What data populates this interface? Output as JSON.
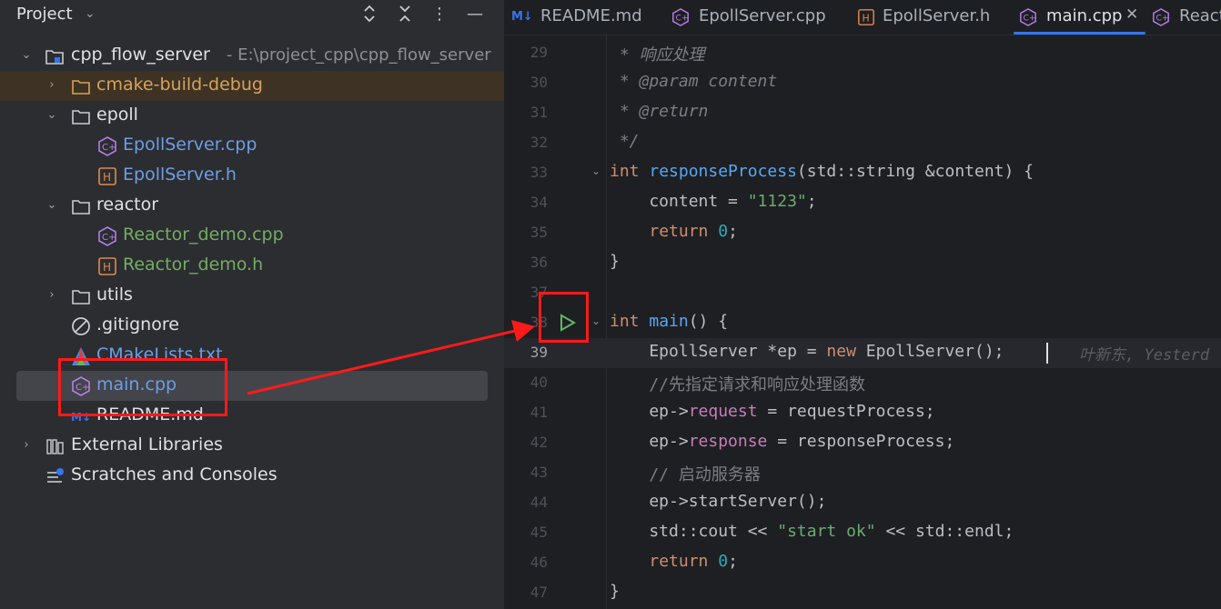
{
  "project_panel": {
    "title": "Project",
    "tree": [
      {
        "label": "cpp_flow_server",
        "extra": "- E:\\project_cpp\\cpp_flow_server",
        "kind": "folder"
      },
      {
        "label": "cmake-build-debug",
        "kind": "folder"
      },
      {
        "label": "epoll",
        "kind": "folder"
      },
      {
        "label": "EpollServer.cpp",
        "kind": "cpp"
      },
      {
        "label": "EpollServer.h",
        "kind": "h"
      },
      {
        "label": "reactor",
        "kind": "folder"
      },
      {
        "label": "Reactor_demo.cpp",
        "kind": "cpp"
      },
      {
        "label": "Reactor_demo.h",
        "kind": "h"
      },
      {
        "label": "utils",
        "kind": "folder"
      },
      {
        "label": ".gitignore",
        "kind": "ignore"
      },
      {
        "label": "CMakeLists.txt",
        "kind": "cmake"
      },
      {
        "label": "main.cpp",
        "kind": "cpp"
      },
      {
        "label": "README.md",
        "kind": "md"
      },
      {
        "label": "External Libraries",
        "kind": "library"
      },
      {
        "label": "Scratches and Consoles",
        "kind": "scratch"
      }
    ]
  },
  "editor": {
    "tabs": [
      {
        "label": "README.md",
        "icon": "markdown-icon"
      },
      {
        "label": "EpollServer.cpp",
        "icon": "cpp-file-icon"
      },
      {
        "label": "EpollServer.h",
        "icon": "header-file-icon"
      },
      {
        "label": "main.cpp",
        "icon": "cpp-file-icon",
        "active": true
      },
      {
        "label": "React",
        "icon": "cpp-file-icon"
      }
    ],
    "current_line": 39,
    "lines": [
      {
        "n": "29",
        "t": " * 响应处理"
      },
      {
        "n": "30",
        "t": " * @param content"
      },
      {
        "n": "31",
        "t": " * @return"
      },
      {
        "n": "32",
        "t": " */"
      },
      {
        "n": "33",
        "t": "int responseProcess(std::string &content) {"
      },
      {
        "n": "34",
        "t": "    content = \"1123\";"
      },
      {
        "n": "35",
        "t": "    return 0;"
      },
      {
        "n": "36",
        "t": "}"
      },
      {
        "n": "37",
        "t": ""
      },
      {
        "n": "38",
        "t": "int main() {"
      },
      {
        "n": "39",
        "t": "    EpollServer *ep = new EpollServer();",
        "hint": "叶新东, Yesterd"
      },
      {
        "n": "40",
        "t": "    //先指定请求和响应处理函数"
      },
      {
        "n": "41",
        "t": "    ep->request = requestProcess;"
      },
      {
        "n": "42",
        "t": "    ep->response = responseProcess;"
      },
      {
        "n": "43",
        "t": "    // 启动服务器"
      },
      {
        "n": "44",
        "t": "    ep->startServer();"
      },
      {
        "n": "45",
        "t": "    std::cout << \"start ok\" << std::endl;"
      },
      {
        "n": "46",
        "t": "    return 0;"
      },
      {
        "n": "47",
        "t": "}"
      }
    ]
  },
  "colors": {
    "panel_bg": "#2b2d30",
    "editor_bg": "#1e1f22",
    "keyword": "#cf8e6d",
    "function": "#56a8f5",
    "string": "#6aab73",
    "number": "#2aacb8",
    "annotation_red": "#ff1a1a",
    "run_green": "#5fb865"
  }
}
